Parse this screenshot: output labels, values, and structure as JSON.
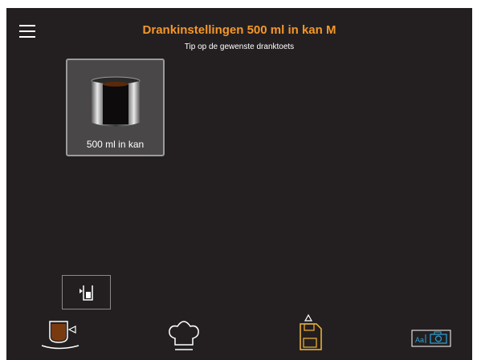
{
  "header": {
    "title": "Drankinstellingen 500 ml in kan M",
    "subtitle": "Tip op de gewenste dranktoets"
  },
  "products": [
    {
      "label": "500 ml in kan",
      "icon": "jug-icon",
      "selected": true
    }
  ],
  "action_button": {
    "icon": "jug-dispense-icon"
  },
  "bottom_nav": [
    {
      "icon": "cup-icon"
    },
    {
      "icon": "chef-hat-icon"
    },
    {
      "icon": "save-icon"
    },
    {
      "icon": "text-photo-icon"
    }
  ],
  "colors": {
    "background": "#231f20",
    "accent": "#f4972a",
    "icon_blue": "#2ea3d8"
  }
}
